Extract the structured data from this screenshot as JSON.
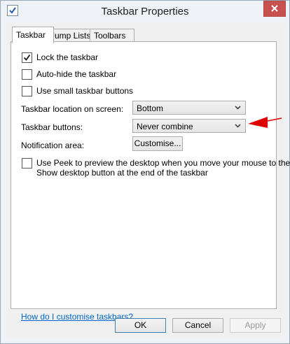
{
  "window": {
    "title": "Taskbar Properties"
  },
  "tabs": [
    {
      "label": "Taskbar",
      "active": true
    },
    {
      "label": "Jump Lists",
      "active": false
    },
    {
      "label": "Toolbars",
      "active": false
    }
  ],
  "options": {
    "lock": {
      "label": "Lock the taskbar",
      "checked": true
    },
    "autohide": {
      "label": "Auto-hide the taskbar",
      "checked": false
    },
    "small_buttons": {
      "label": "Use small taskbar buttons",
      "checked": false
    }
  },
  "location": {
    "label": "Taskbar location on screen:",
    "value": "Bottom"
  },
  "buttons_combine": {
    "label": "Taskbar buttons:",
    "value": "Never combine"
  },
  "notification": {
    "label": "Notification area:",
    "button": "Customise..."
  },
  "peek": {
    "line1": "Use Peek to preview the desktop when you move your mouse to the",
    "line2": "Show desktop button at the end of the taskbar",
    "checked": false
  },
  "help_link": "How do I customise taskbars?",
  "footer": {
    "ok": "OK",
    "cancel": "Cancel",
    "apply": "Apply"
  },
  "colors": {
    "accent_arrow": "#e00000",
    "link": "#0066cc",
    "close": "#c75050"
  }
}
